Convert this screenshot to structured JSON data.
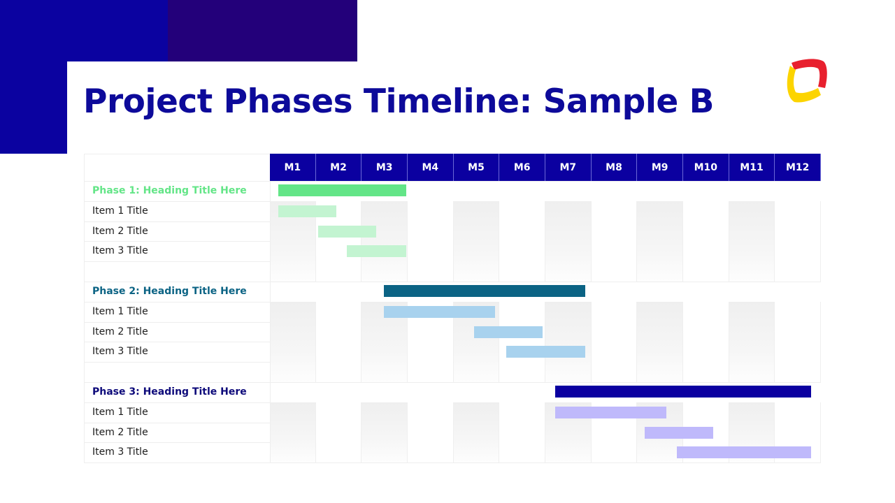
{
  "slide": {
    "title": "Project Phases Timeline: Sample B"
  },
  "logo": {
    "icon": "rounded-square-logo-icon",
    "colors": [
      "#e8202e",
      "#fcd400"
    ]
  },
  "colors": {
    "header_bg": "#0b00a0",
    "deco_primary": "#0b02a0",
    "deco_secondary": "#23007a"
  },
  "chart_data": {
    "type": "gantt",
    "title": "Project Phases Timeline: Sample B",
    "x_unit": "months (0 = start of M1)",
    "categories": [
      "M1",
      "M2",
      "M3",
      "M4",
      "M5",
      "M6",
      "M7",
      "M8",
      "M9",
      "M10",
      "M11",
      "M12"
    ],
    "xlim": [
      0,
      12
    ],
    "phases": [
      {
        "label": "Phase 1: Heading Title Here",
        "color": "#63e587",
        "item_color": "#c3f4d1",
        "start": 0.18,
        "end": 2.97,
        "items": [
          {
            "label": "Item 1 Title",
            "start": 0.18,
            "end": 1.45
          },
          {
            "label": "Item 2 Title",
            "start": 1.05,
            "end": 2.32
          },
          {
            "label": "Item 3 Title",
            "start": 1.68,
            "end": 2.97
          }
        ]
      },
      {
        "label": "Phase 2: Heading Title Here",
        "color": "#0b6384",
        "item_color": "#a8d2ee",
        "start": 2.48,
        "end": 6.87,
        "items": [
          {
            "label": "Item 1 Title",
            "start": 2.48,
            "end": 4.9
          },
          {
            "label": "Item 2 Title",
            "start": 4.45,
            "end": 5.94
          },
          {
            "label": "Item 3 Title",
            "start": 5.14,
            "end": 6.87
          }
        ]
      },
      {
        "label": "Phase 3: Heading Title Here",
        "color": "#0b00a0",
        "item_color": "#bfb9fb",
        "start": 6.22,
        "end": 11.78,
        "items": [
          {
            "label": "Item 1 Title",
            "start": 6.22,
            "end": 8.63
          },
          {
            "label": "Item 2 Title",
            "start": 8.17,
            "end": 9.66
          },
          {
            "label": "Item 3 Title",
            "start": 8.87,
            "end": 11.78
          }
        ]
      }
    ]
  }
}
